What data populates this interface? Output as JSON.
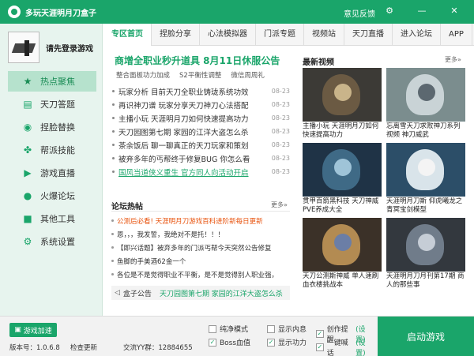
{
  "window": {
    "title": "多玩天涯明月刀盒子",
    "feedback": "意见反馈",
    "controls": [
      {
        "name": "settings-icon",
        "glyph": "⚙"
      },
      {
        "name": "minimize-icon",
        "glyph": "—"
      },
      {
        "name": "close-icon",
        "glyph": "✕"
      }
    ]
  },
  "sidebar": {
    "login_text": "请先登录游戏",
    "items": [
      {
        "label": "热点聚焦",
        "icon": "star-icon",
        "glyph": "★",
        "active": true
      },
      {
        "label": "天刀答题",
        "icon": "document-icon",
        "glyph": "▤",
        "active": false
      },
      {
        "label": "捏脸替换",
        "icon": "face-icon",
        "glyph": "◉",
        "active": false
      },
      {
        "label": "帮派技能",
        "icon": "pinwheel-icon",
        "glyph": "✤",
        "active": false
      },
      {
        "label": "游戏直播",
        "icon": "play-icon",
        "glyph": "▶",
        "active": false
      },
      {
        "label": "火爆论坛",
        "icon": "chat-icon",
        "glyph": "●",
        "active": false
      },
      {
        "label": "其他工具",
        "icon": "box-icon",
        "glyph": "■",
        "active": false
      },
      {
        "label": "系统设置",
        "icon": "gear-icon",
        "glyph": "⚙",
        "active": false
      }
    ]
  },
  "tabs": [
    "专区首页",
    "捏脸分享",
    "心法模拟器",
    "门派专题",
    "视频站",
    "天刀直播",
    "进入论坛",
    "APP"
  ],
  "news": {
    "headline": "商增全职业秒升道具 8月11日休服公告",
    "sublinks": [
      "整合面板功力加成",
      "S2平衡性调整",
      "微信周周礼"
    ],
    "items": [
      {
        "text": "玩家分析 目前天刀全职业铸珑系统功效",
        "date": "08-23"
      },
      {
        "text": "再识神刀谱 玩家分享天刀神刀心法搭配",
        "date": "08-23"
      },
      {
        "text": "主播小玩 天涯明月刀如何快速提高功力",
        "date": "08-23"
      },
      {
        "text": "天刀园图第七期 家园的江洋大盗怎么杀",
        "date": "08-23"
      },
      {
        "text": "茶余饭后 聊一聊真正的天刀玩家和策划",
        "date": "08-23"
      },
      {
        "text": "被弃多年的丐帮终于修复BUG 你怎么看",
        "date": "08-23"
      },
      {
        "text": "国风当道侠义重生 官方同人向活动开启",
        "date": "08-23"
      }
    ]
  },
  "forum": {
    "title": "论坛热帖",
    "more": "更多»",
    "items": [
      {
        "text": "公测后必看! 天涯明月刀游戏百科进阶新每日更新",
        "hot": true
      },
      {
        "text": "恩，，，我发誓，我绝对不是托！！！",
        "hot": false
      },
      {
        "text": "【即兴话题】被弃多年的门派丐帮今天突然公告修复",
        "hot": false
      },
      {
        "text": "鱼脚的手美酒62金一个",
        "hot": false
      },
      {
        "text": "各位是不是觉得职业不平衡，是不是觉得别人职业强，",
        "hot": false
      }
    ]
  },
  "notice": {
    "label": "盒子公告",
    "text": "天刀园图第七期 家园的江洋大盗怎么杀"
  },
  "videos": {
    "title": "最新视频",
    "more": "更多»",
    "items": [
      {
        "caption": "主播小玩 天涯明月刀如何快速提高功力",
        "bg": "#3c3a36",
        "fg1": "#6b5a43",
        "fg2": "#c9b48a"
      },
      {
        "caption": "忘离雪天刀求败神刀系列视频 神刀威武",
        "bg": "#7b8d8e",
        "fg1": "#c9d3d6",
        "fg2": "#5c6870"
      },
      {
        "caption": "贯甲百箭黑科技 天刀神威PVE养成大全",
        "bg": "#1f3346",
        "fg1": "#3f6a86",
        "fg2": "#9fc4d8"
      },
      {
        "caption": "天涯明月刀斯 仰虎曦龙之青冥宝剑模型",
        "bg": "#2c4e68",
        "fg1": "#d9e4ea",
        "fg2": "#f4f4f4"
      },
      {
        "caption": "天刀公测斯神威 单人速刷血衣楼挑战本",
        "bg": "#3b3128",
        "fg1": "#b38b52",
        "fg2": "#6b7ea6"
      },
      {
        "caption": "天涯明月刀月刊第17期 商人的那些事",
        "bg": "#33383e",
        "fg1": "#707c8a",
        "fg2": "#c6cdd6"
      }
    ]
  },
  "footer": {
    "accel_label": "游戏加速",
    "version": "版本号：1.0.6.8",
    "check_update": "检查更新",
    "qq_group": "交流YY群：12884655",
    "options": [
      {
        "label": "纯净模式",
        "checked": false,
        "setting": ""
      },
      {
        "label": "显示内息",
        "checked": false,
        "setting": ""
      },
      {
        "label": "创作提醒",
        "checked": true,
        "setting": "(设置)"
      },
      {
        "label": "Boss血值",
        "checked": true,
        "setting": ""
      },
      {
        "label": "显示功力",
        "checked": true,
        "setting": ""
      },
      {
        "label": "一键喊话",
        "checked": true,
        "setting": "(设置)"
      }
    ],
    "start_label": "启动游戏"
  },
  "colors": {
    "accent": "#1aa56a",
    "hot": "#e8520c"
  }
}
